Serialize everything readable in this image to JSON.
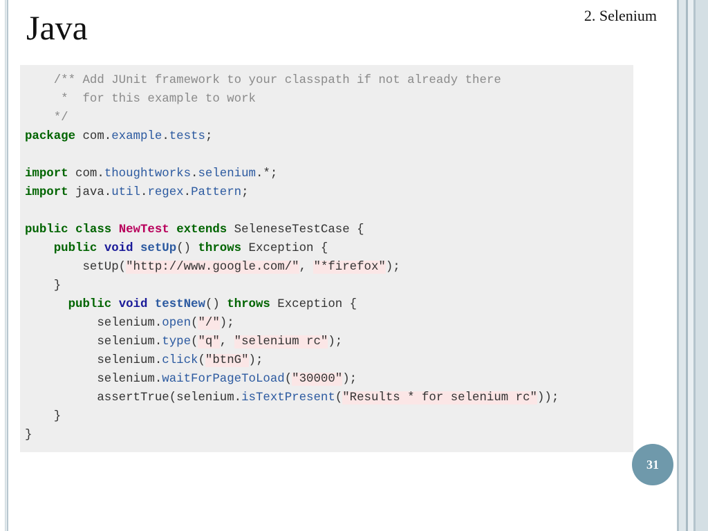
{
  "slide": {
    "title": "Java",
    "section": "2. Selenium",
    "page_number": "31"
  },
  "code": {
    "lines": [
      "    /** Add JUnit framework to your classpath if not already there",
      "     *  for this example to work",
      "    */",
      "package com.example.tests;",
      "",
      "import com.thoughtworks.selenium.*;",
      "import java.util.regex.Pattern;",
      "",
      "public class NewTest extends SeleneseTestCase {",
      "    public void setUp() throws Exception {",
      "        setUp(\"http://www.google.com/\", \"*firefox\");",
      "    }",
      "      public void testNew() throws Exception {",
      "          selenium.open(\"/\");",
      "          selenium.type(\"q\", \"selenium rc\");",
      "          selenium.click(\"btnG\");",
      "          selenium.waitForPageToLoad(\"30000\");",
      "          assertTrue(selenium.isTextPresent(\"Results * for selenium rc\"));",
      "    }",
      "}"
    ]
  }
}
